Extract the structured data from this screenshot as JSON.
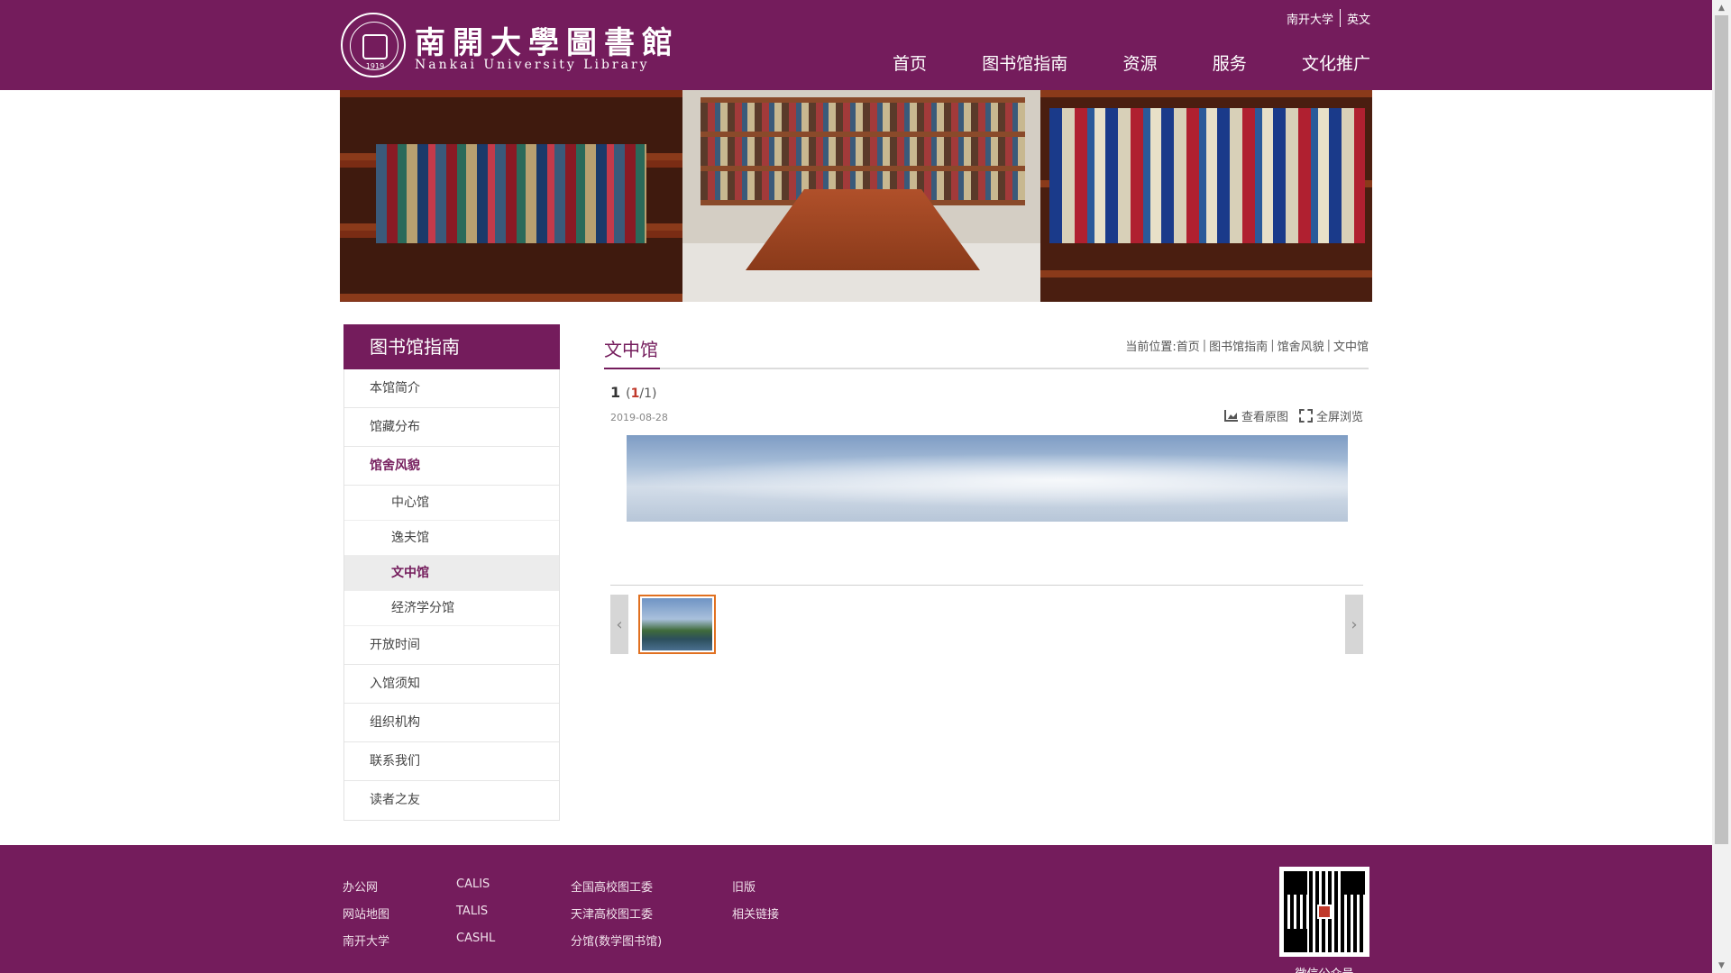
{
  "header": {
    "logo_cn": "南開大學圖書館",
    "logo_en": "Nankai University Library",
    "logo_year": "1919",
    "top_links": [
      "南开大学",
      "英文"
    ],
    "nav": [
      "首页",
      "图书馆指南",
      "资源",
      "服务",
      "文化推广"
    ]
  },
  "sidebar": {
    "title": "图书馆指南",
    "items": [
      {
        "label": "本馆简介"
      },
      {
        "label": "馆藏分布"
      },
      {
        "label": "馆舍风貌"
      },
      {
        "label": "中心馆"
      },
      {
        "label": "逸夫馆"
      },
      {
        "label": "文中馆"
      },
      {
        "label": "经济学分馆"
      },
      {
        "label": "开放时间"
      },
      {
        "label": "入馆须知"
      },
      {
        "label": "组织机构"
      },
      {
        "label": "联系我们"
      },
      {
        "label": "读者之友"
      }
    ]
  },
  "content": {
    "title": "文中馆",
    "breadcrumb_prefix": "当前位置:",
    "breadcrumb": [
      "首页",
      "图书馆指南",
      "馆舍风貌",
      "文中馆"
    ],
    "breadcrumb_sep": "|",
    "picture_number": "1",
    "counter_open": "(",
    "counter_current": "1",
    "counter_total": "/1)",
    "date": "2019-08-28",
    "action_view_original": "查看原图",
    "action_fullscreen": "全屏浏览",
    "prev_arrow": "‹",
    "next_arrow": "›"
  },
  "footer": {
    "col1": [
      "办公网",
      "网站地图",
      "南开大学"
    ],
    "col2": [
      "CALIS",
      "TALIS",
      "CASHL"
    ],
    "col3": [
      "全国高校图工委",
      "天津高校图工委",
      "分馆(数学图书馆)"
    ],
    "col4": [
      "旧版",
      "相关链接"
    ],
    "qr_caption": "微信公众号"
  },
  "colors": {
    "brand": "#741c5c",
    "accent_red": "#c0392b",
    "thumb_border": "#e07020"
  }
}
